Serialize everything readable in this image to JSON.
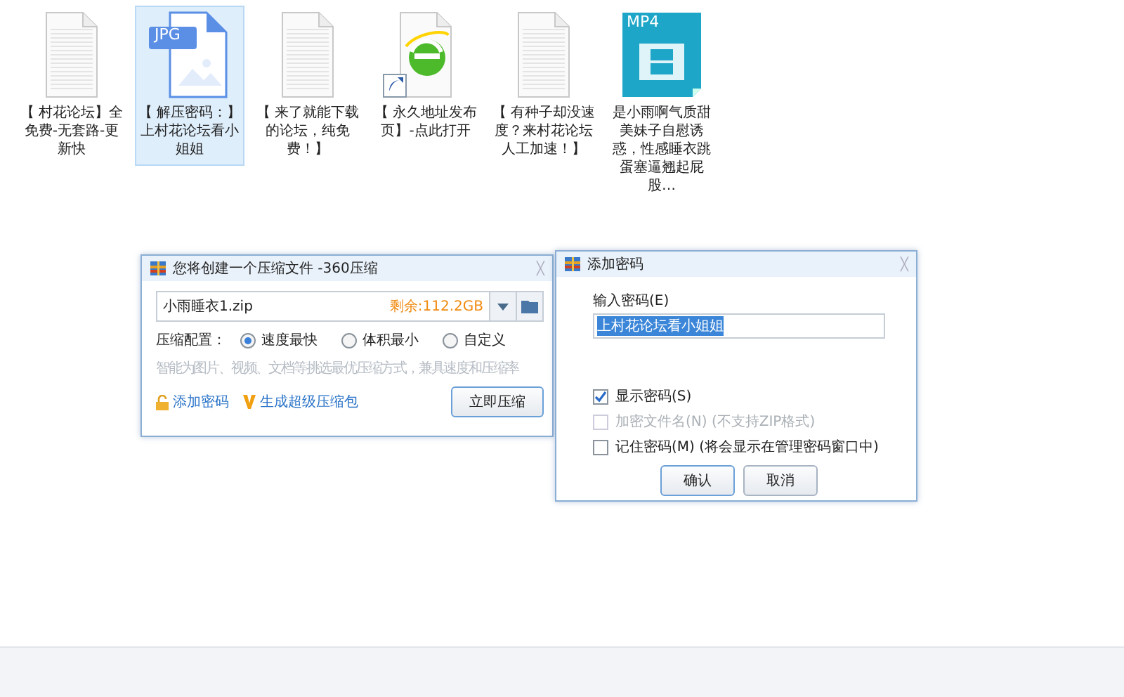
{
  "desktop_icons": [
    {
      "kind": "text",
      "label": "【 村花论坛】全免费-无套路-更新快",
      "selected": false
    },
    {
      "kind": "jpg",
      "badge": "JPG",
      "label": "【 解压密码：】上村花论坛看小姐姐",
      "selected": true
    },
    {
      "kind": "text",
      "label": "【 来了就能下载的论坛，纯免费！】",
      "selected": false
    },
    {
      "kind": "shortcut",
      "label": "【 永久地址发布页】-点此打开",
      "selected": false
    },
    {
      "kind": "text",
      "label": "【 有种子却没速度？来村花论坛人工加速！】",
      "selected": false
    },
    {
      "kind": "mp4",
      "badge": "MP4",
      "label": "是小雨啊气质甜美妹子自慰诱惑，性感睡衣跳蛋塞逼翘起屁股…",
      "selected": false
    }
  ],
  "compress_dialog": {
    "title": "您将创建一个压缩文件 -360压缩",
    "close": "╳",
    "file_name": "小雨睡衣1.zip",
    "free_space": "剩余:112.2GB",
    "config_label": "压缩配置：",
    "options": [
      {
        "label": "速度最快",
        "selected": true
      },
      {
        "label": "体积最小",
        "selected": false
      },
      {
        "label": "自定义",
        "selected": false
      }
    ],
    "hint": "智能为图片、视频、文档等挑选最优压缩方式，兼具速度和压缩率",
    "add_password": "添加密码",
    "super_pack": "生成超级压缩包",
    "compress_button": "立即压缩"
  },
  "password_dialog": {
    "title": "添加密码",
    "close": "╳",
    "password_label": "输入密码(E)",
    "password_value": "上村花论坛看小姐姐",
    "checkboxes": [
      {
        "label": "显示密码(S)",
        "checked": true,
        "disabled": false
      },
      {
        "label": "加密文件名(N) (不支持ZIP格式)",
        "checked": false,
        "disabled": true
      },
      {
        "label": "记住密码(M) (将会显示在管理密码窗口中)",
        "checked": false,
        "disabled": false
      }
    ],
    "buttons": [
      "确认",
      "取消"
    ]
  }
}
